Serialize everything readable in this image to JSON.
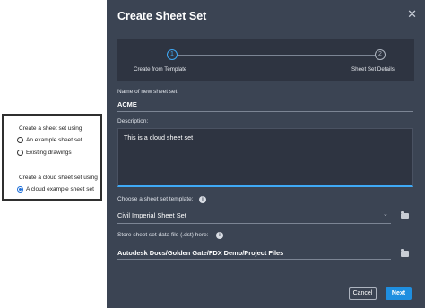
{
  "inset": {
    "group1_title": "Create a sheet set using",
    "options1": [
      {
        "label": "An example sheet set",
        "selected": false
      },
      {
        "label": "Existing drawings",
        "selected": false
      }
    ],
    "group2_title": "Create a cloud sheet set using",
    "options2": [
      {
        "label": "A cloud example sheet set",
        "selected": true
      }
    ]
  },
  "dialog": {
    "title": "Create Sheet Set",
    "close_icon": "close-icon",
    "steps": [
      {
        "number": "1",
        "label": "Create from Template",
        "active": true
      },
      {
        "number": "2",
        "label": "Sheet Set Details",
        "active": false
      }
    ],
    "name_label": "Name of new sheet set:",
    "name_value": "ACME",
    "description_label": "Description:",
    "description_value": "This is a cloud sheet set",
    "template_label": "Choose a sheet set template:",
    "template_value": "Civil Imperial Sheet Set",
    "store_label": "Store sheet set data file (.dst) here:",
    "store_value": "Autodesk Docs/Golden Gate/FDX Demo/Project Files",
    "info_glyph": "i",
    "cancel_label": "Cancel",
    "next_label": "Next",
    "accent_color": "#1f8fe0",
    "background_color": "#3b4453"
  }
}
